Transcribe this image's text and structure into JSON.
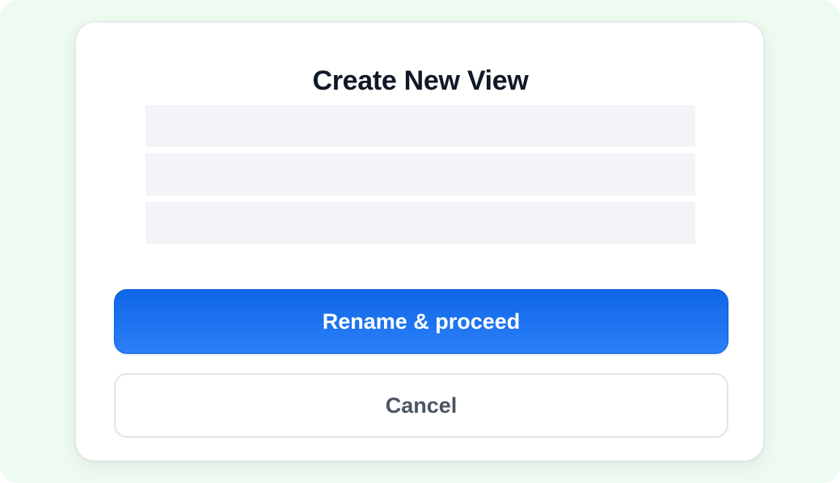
{
  "dialog": {
    "title": "Create New View",
    "primary_button_label": "Rename & proceed",
    "secondary_button_label": "Cancel"
  },
  "colors": {
    "backdrop": "#eefbf1",
    "primary_button": "#1a72ee",
    "primary_button_text": "#ffffff",
    "secondary_button_text": "#4b5563",
    "skeleton": "#f3f4f7",
    "title_text": "#111827"
  }
}
